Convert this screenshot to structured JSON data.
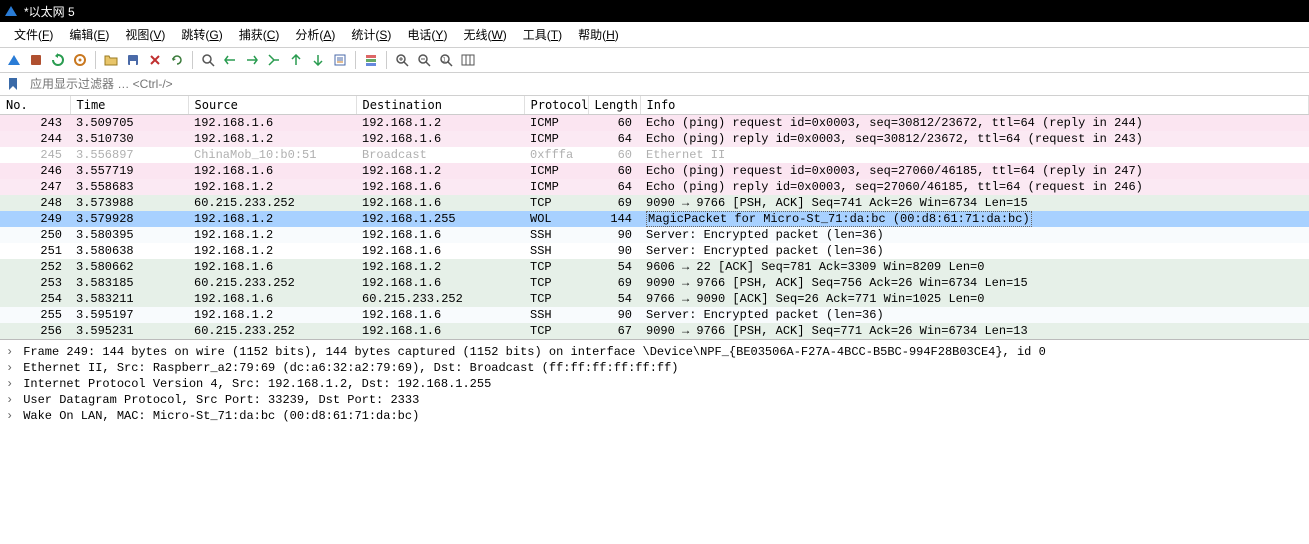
{
  "title": "*以太网 5",
  "menus": [
    "文件(F)",
    "编辑(E)",
    "视图(V)",
    "跳转(G)",
    "捕获(C)",
    "分析(A)",
    "统计(S)",
    "电话(Y)",
    "无线(W)",
    "工具(T)",
    "帮助(H)"
  ],
  "filter_placeholder": "应用显示过滤器 … <Ctrl-/>",
  "columns": [
    "No.",
    "Time",
    "Source",
    "Destination",
    "Protocol",
    "Length",
    "Info"
  ],
  "packets": [
    {
      "no": "243",
      "time": "3.509705",
      "src": "192.168.1.6",
      "dst": "192.168.1.2",
      "proto": "ICMP",
      "len": "60",
      "info": "Echo (ping) request  id=0x0003, seq=30812/23672, ttl=64 (reply in 244)",
      "cls": "row-pink"
    },
    {
      "no": "244",
      "time": "3.510730",
      "src": "192.168.1.2",
      "dst": "192.168.1.6",
      "proto": "ICMP",
      "len": "64",
      "info": "Echo (ping) reply    id=0x0003, seq=30812/23672, ttl=64 (request in 243)",
      "cls": "row-pink2"
    },
    {
      "no": "245",
      "time": "3.556897",
      "src": "ChinaMob_10:b0:51",
      "dst": "Broadcast",
      "proto": "0xfffa",
      "len": "60",
      "info": "Ethernet II",
      "cls": "row-grey"
    },
    {
      "no": "246",
      "time": "3.557719",
      "src": "192.168.1.6",
      "dst": "192.168.1.2",
      "proto": "ICMP",
      "len": "60",
      "info": "Echo (ping) request  id=0x0003, seq=27060/46185, ttl=64 (reply in 247)",
      "cls": "row-pink"
    },
    {
      "no": "247",
      "time": "3.558683",
      "src": "192.168.1.2",
      "dst": "192.168.1.6",
      "proto": "ICMP",
      "len": "64",
      "info": "Echo (ping) reply    id=0x0003, seq=27060/46185, ttl=64 (request in 246)",
      "cls": "row-pink2"
    },
    {
      "no": "248",
      "time": "3.573988",
      "src": "60.215.233.252",
      "dst": "192.168.1.6",
      "proto": "TCP",
      "len": "69",
      "info": "9090 → 9766 [PSH, ACK] Seq=741 Ack=26 Win=6734 Len=15",
      "cls": "row-teal"
    },
    {
      "no": "249",
      "time": "3.579928",
      "src": "192.168.1.2",
      "dst": "192.168.1.255",
      "proto": "WOL",
      "len": "144",
      "info": "MagicPacket for Micro-St_71:da:bc (00:d8:61:71:da:bc)",
      "cls": "row-sel",
      "dotted": true
    },
    {
      "no": "250",
      "time": "3.580395",
      "src": "192.168.1.2",
      "dst": "192.168.1.6",
      "proto": "SSH",
      "len": "90",
      "info": "Server: Encrypted packet (len=36)",
      "cls": "row-white"
    },
    {
      "no": "251",
      "time": "3.580638",
      "src": "192.168.1.2",
      "dst": "192.168.1.6",
      "proto": "SSH",
      "len": "90",
      "info": "Server: Encrypted packet (len=36)",
      "cls": "row-white2"
    },
    {
      "no": "252",
      "time": "3.580662",
      "src": "192.168.1.6",
      "dst": "192.168.1.2",
      "proto": "TCP",
      "len": "54",
      "info": "9606 → 22 [ACK] Seq=781 Ack=3309 Win=8209 Len=0",
      "cls": "row-teal"
    },
    {
      "no": "253",
      "time": "3.583185",
      "src": "60.215.233.252",
      "dst": "192.168.1.6",
      "proto": "TCP",
      "len": "69",
      "info": "9090 → 9766 [PSH, ACK] Seq=756 Ack=26 Win=6734 Len=15",
      "cls": "row-teal"
    },
    {
      "no": "254",
      "time": "3.583211",
      "src": "192.168.1.6",
      "dst": "60.215.233.252",
      "proto": "TCP",
      "len": "54",
      "info": "9766 → 9090 [ACK] Seq=26 Ack=771 Win=1025 Len=0",
      "cls": "row-teal"
    },
    {
      "no": "255",
      "time": "3.595197",
      "src": "192.168.1.2",
      "dst": "192.168.1.6",
      "proto": "SSH",
      "len": "90",
      "info": "Server: Encrypted packet (len=36)",
      "cls": "row-white"
    },
    {
      "no": "256",
      "time": "3.595231",
      "src": "60.215.233.252",
      "dst": "192.168.1.6",
      "proto": "TCP",
      "len": "67",
      "info": "9090 → 9766 [PSH, ACK] Seq=771 Ack=26 Win=6734 Len=13",
      "cls": "row-teal"
    }
  ],
  "details": [
    "Frame 249: 144 bytes on wire (1152 bits), 144 bytes captured (1152 bits) on interface \\Device\\NPF_{BE03506A-F27A-4BCC-B5BC-994F28B03CE4}, id 0",
    "Ethernet II, Src: Raspberr_a2:79:69 (dc:a6:32:a2:79:69), Dst: Broadcast (ff:ff:ff:ff:ff:ff)",
    "Internet Protocol Version 4, Src: 192.168.1.2, Dst: 192.168.1.255",
    "User Datagram Protocol, Src Port: 33239, Dst Port: 2333",
    "Wake On LAN, MAC: Micro-St_71:da:bc (00:d8:61:71:da:bc)"
  ]
}
